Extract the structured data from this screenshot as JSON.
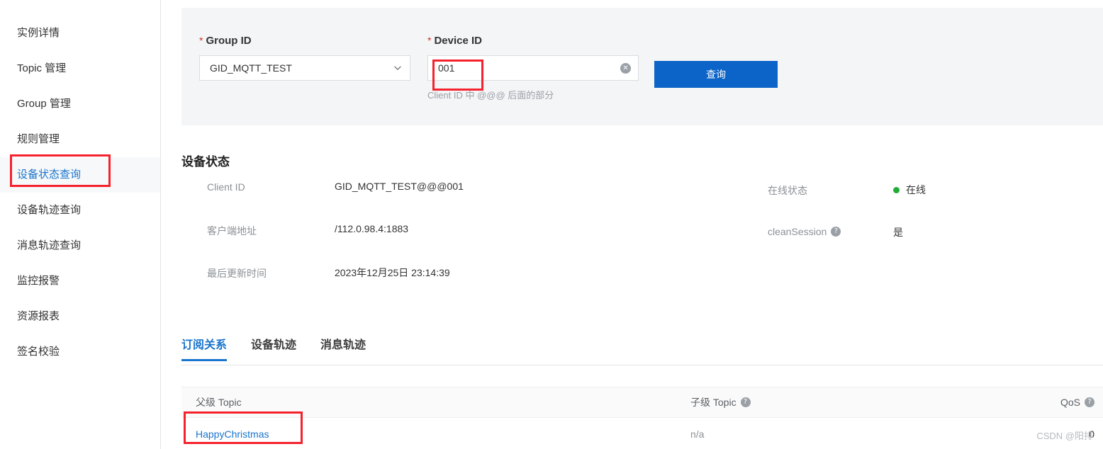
{
  "sidebar": {
    "items": [
      {
        "label": "实例详情",
        "active": false
      },
      {
        "label": "Topic 管理",
        "active": false
      },
      {
        "label": "Group 管理",
        "active": false
      },
      {
        "label": "规则管理",
        "active": false
      },
      {
        "label": "设备状态查询",
        "active": true
      },
      {
        "label": "设备轨迹查询",
        "active": false
      },
      {
        "label": "消息轨迹查询",
        "active": false
      },
      {
        "label": "监控报警",
        "active": false
      },
      {
        "label": "资源报表",
        "active": false
      },
      {
        "label": "签名校验",
        "active": false
      }
    ]
  },
  "search": {
    "group_id": {
      "required_mark": "*",
      "label": "Group ID",
      "value": "GID_MQTT_TEST",
      "chevron_icon": "chevron-down-icon"
    },
    "device_id": {
      "required_mark": "*",
      "label": "Device ID",
      "value": "001",
      "placeholder": "",
      "clear_icon": "✕",
      "hint": "Client ID 中 @@@ 后面的部分"
    },
    "query_button": "查询"
  },
  "device_status": {
    "title": "设备状态",
    "rows": [
      {
        "left_label": "Client ID",
        "left_value": "GID_MQTT_TEST@@@001",
        "right_label": "在线状态",
        "right_value": "在线",
        "right_has_dot": true,
        "right_has_help": false
      },
      {
        "left_label": "客户端地址",
        "left_value": "/112.0.98.4:1883",
        "right_label": "cleanSession",
        "right_value": "是",
        "right_has_dot": false,
        "right_has_help": true
      },
      {
        "left_label": "最后更新时间",
        "left_value": "2023年12月25日 23:14:39",
        "right_label": "",
        "right_value": "",
        "right_has_dot": false,
        "right_has_help": false
      }
    ]
  },
  "tabs": [
    {
      "label": "订阅关系",
      "active": true
    },
    {
      "label": "设备轨迹",
      "active": false
    },
    {
      "label": "消息轨迹",
      "active": false
    }
  ],
  "table": {
    "columns": [
      {
        "label": "父级 Topic",
        "help": false
      },
      {
        "label": "子级 Topic",
        "help": true
      },
      {
        "label": "QoS",
        "help": true
      }
    ],
    "rows": [
      {
        "parent_topic": "HappyChristmas",
        "child_topic": "n/a",
        "qos": "0"
      }
    ]
  },
  "help_icon_glyph": "?",
  "watermark": "CSDN @阳排",
  "colors": {
    "accent_blue": "#1874cd",
    "button_blue": "#0c64c8",
    "annotation_red": "#f5222d",
    "online_green": "#22ac38",
    "panel_grey": "#f4f5f7"
  }
}
